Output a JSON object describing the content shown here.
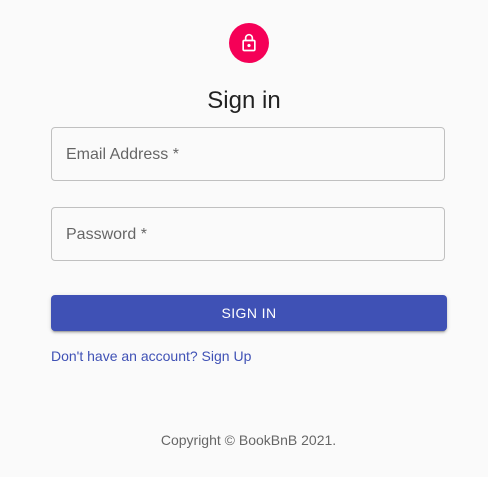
{
  "header": {
    "icon": "lock-outlined-icon",
    "title": "Sign in"
  },
  "form": {
    "email": {
      "label": "Email Address *",
      "value": ""
    },
    "password": {
      "label": "Password *",
      "value": ""
    },
    "submit_label": "SIGN IN",
    "signup_link": "Don't have an account? Sign Up"
  },
  "footer": {
    "copyright": "Copyright © BookBnB 2021."
  },
  "colors": {
    "avatar": "#f50057",
    "primary": "#3f51b5",
    "background": "#fafafa"
  }
}
